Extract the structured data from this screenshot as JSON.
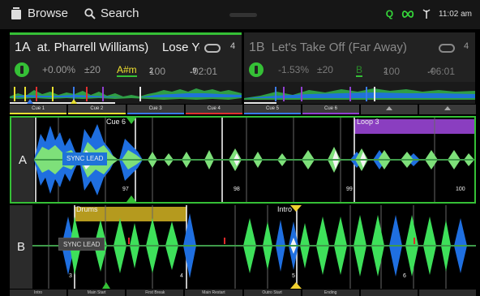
{
  "topbar": {
    "browse_label": "Browse",
    "search_label": "Search",
    "quantize_label": "Q",
    "time": "11:02 am",
    "icons": [
      "folder-icon",
      "search-icon",
      "link-icon",
      "antenna-icon"
    ]
  },
  "deckA": {
    "number": "1A",
    "title": "at. Pharrell Williams)",
    "title_next": "Lose Yours",
    "loop_beats": "4",
    "pitch": "+0.00%",
    "range": "±20",
    "key": "A#m",
    "bpm": "100",
    "bpm_decimal": "2",
    "time_remaining": "-02:01",
    "time_decimal": "9"
  },
  "deckB": {
    "number": "1B",
    "title": "Let's Take Off (Far Away)",
    "loop_beats": "4",
    "pitch": "-1.53%",
    "range": "±20",
    "key": "B",
    "bpm": "100",
    "bpm_decimal": "2",
    "time_remaining": "-06:01",
    "time_decimal": "4"
  },
  "cuesA": [
    {
      "label": "Cue 1",
      "color": "#e8e030"
    },
    {
      "label": "Cue 2",
      "color": "#e8e030"
    },
    {
      "label": "Cue 3",
      "color": "#3a7ae8"
    },
    {
      "label": "Cue 4",
      "color": "#e03030"
    }
  ],
  "cuesB": [
    {
      "label": "Cue 5",
      "color": "#3a7ae8"
    },
    {
      "label": "Cue 6",
      "color": "#9040d0"
    }
  ],
  "waveformA": {
    "letter": "A",
    "sync_label": "SYNC LEAD",
    "cue_label": "Cue 6",
    "loop_label": "Loop 3",
    "beat_markers": [
      "97",
      "98",
      "99",
      "100"
    ]
  },
  "waveformB": {
    "letter": "B",
    "sync_label": "SYNC LEAD",
    "section_label": "Drums",
    "intro_label": "Intro",
    "beat_markers": [
      "3",
      "4",
      "5",
      "6"
    ]
  },
  "bottom_pads": [
    "Intro",
    "Main Start",
    "First Break",
    "Main Restart",
    "Outro Start",
    "Ending",
    "",
    ""
  ],
  "colors": {
    "accent": "#35c036",
    "blue": "#1f73d8",
    "loop": "#8a3ec0",
    "section": "#b59a1e"
  }
}
